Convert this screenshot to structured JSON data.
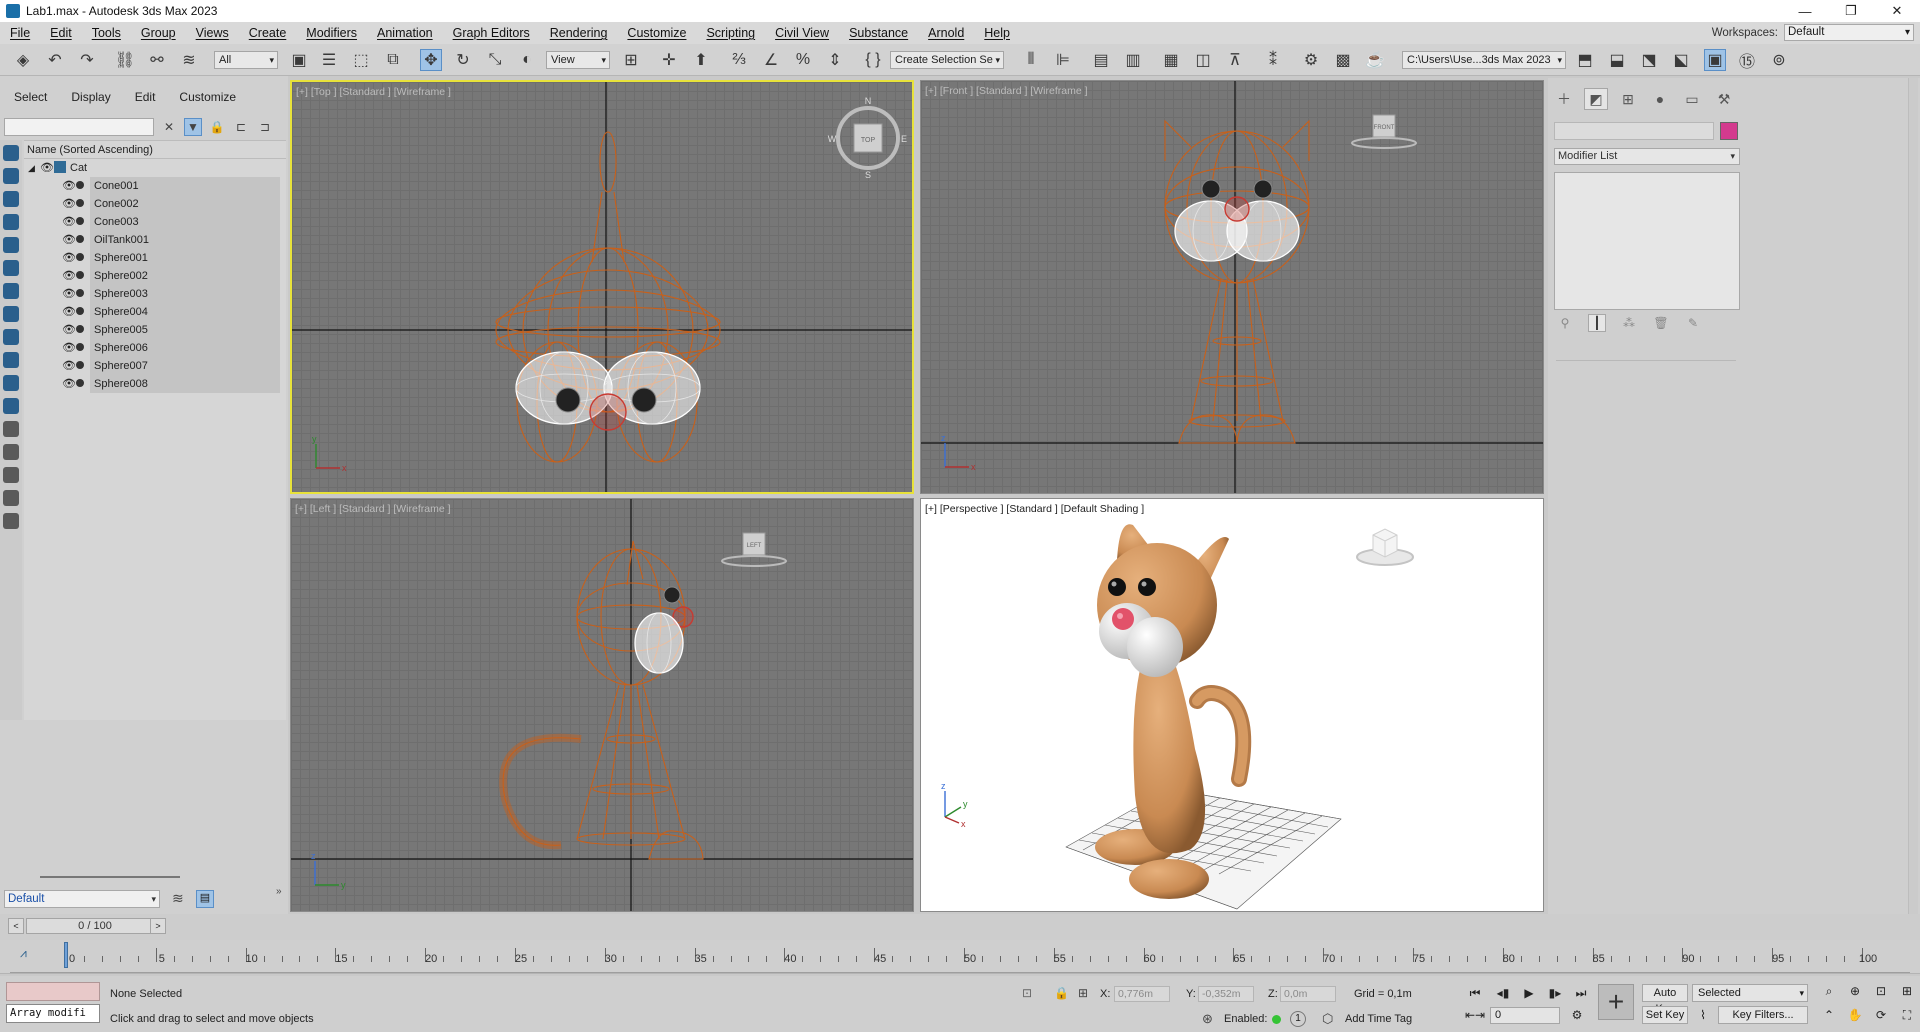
{
  "window": {
    "title": "Lab1.max - Autodesk 3ds Max 2023",
    "min": "—",
    "max": "❐",
    "close": "✕"
  },
  "menus": [
    "File",
    "Edit",
    "Tools",
    "Group",
    "Views",
    "Create",
    "Modifiers",
    "Animation",
    "Graph Editors",
    "Rendering",
    "Customize",
    "Scripting",
    "Civil View",
    "Substance",
    "Arnold",
    "Help"
  ],
  "workspace": {
    "label": "Workspaces:",
    "value": "Default"
  },
  "toolbar": {
    "selection_filter": "All",
    "ref_coord": "View",
    "named_selection": "Create Selection Se",
    "project_path": "C:\\Users\\Use...3ds Max 2023"
  },
  "scene_explorer": {
    "tabs": [
      "Select",
      "Display",
      "Edit",
      "Customize"
    ],
    "header": "Name (Sorted Ascending)",
    "root": "Cat",
    "items": [
      "Cone001",
      "Cone002",
      "Cone003",
      "OilTank001",
      "Sphere001",
      "Sphere002",
      "Sphere003",
      "Sphere004",
      "Sphere005",
      "Sphere006",
      "Sphere007",
      "Sphere008"
    ],
    "layer": "Default"
  },
  "viewports": {
    "top": {
      "label": "[+] [Top ] [Standard ] [Wireframe ]",
      "cube": "TOP",
      "compass": [
        "N",
        "S",
        "E",
        "W"
      ]
    },
    "front": {
      "label": "[+] [Front ] [Standard ] [Wireframe ]",
      "cube": "FRONT"
    },
    "left": {
      "label": "[+] [Left ] [Standard ] [Wireframe ]",
      "cube": "LEFT"
    },
    "persp": {
      "label": "[+] [Perspective ] [Standard ] [Default Shading ]"
    },
    "axis": {
      "x": "x",
      "y": "y",
      "z": "z"
    }
  },
  "command_panel": {
    "modifier_list": "Modifier List"
  },
  "time": {
    "slider": "0 / 100",
    "ticks": [
      "0",
      "5",
      "10",
      "15",
      "20",
      "25",
      "30",
      "35",
      "40",
      "45",
      "50",
      "55",
      "60",
      "65",
      "70",
      "75",
      "80",
      "85",
      "90",
      "95",
      "100"
    ]
  },
  "status": {
    "maxscript": "Array modifi",
    "selection": "None Selected",
    "prompt": "Click and drag to select and move objects",
    "x_label": "X:",
    "x_value": "0,776m",
    "y_label": "Y:",
    "y_value": "-0,352m",
    "z_label": "Z:",
    "z_value": "0,0m",
    "grid": "Grid = 0,1m",
    "enabled": "Enabled:",
    "enabled_num": "1",
    "add_time_tag": "Add Time Tag",
    "frame": "0",
    "auto_key": "Auto Key",
    "set_key": "Set Key",
    "key_mode": "Selected",
    "key_filters": "Key Filters..."
  },
  "colors": {
    "wire": "#c8601a",
    "active_border": "#e8e23a",
    "accent": "#9fc3e6",
    "object_color": "#d43a8e"
  }
}
